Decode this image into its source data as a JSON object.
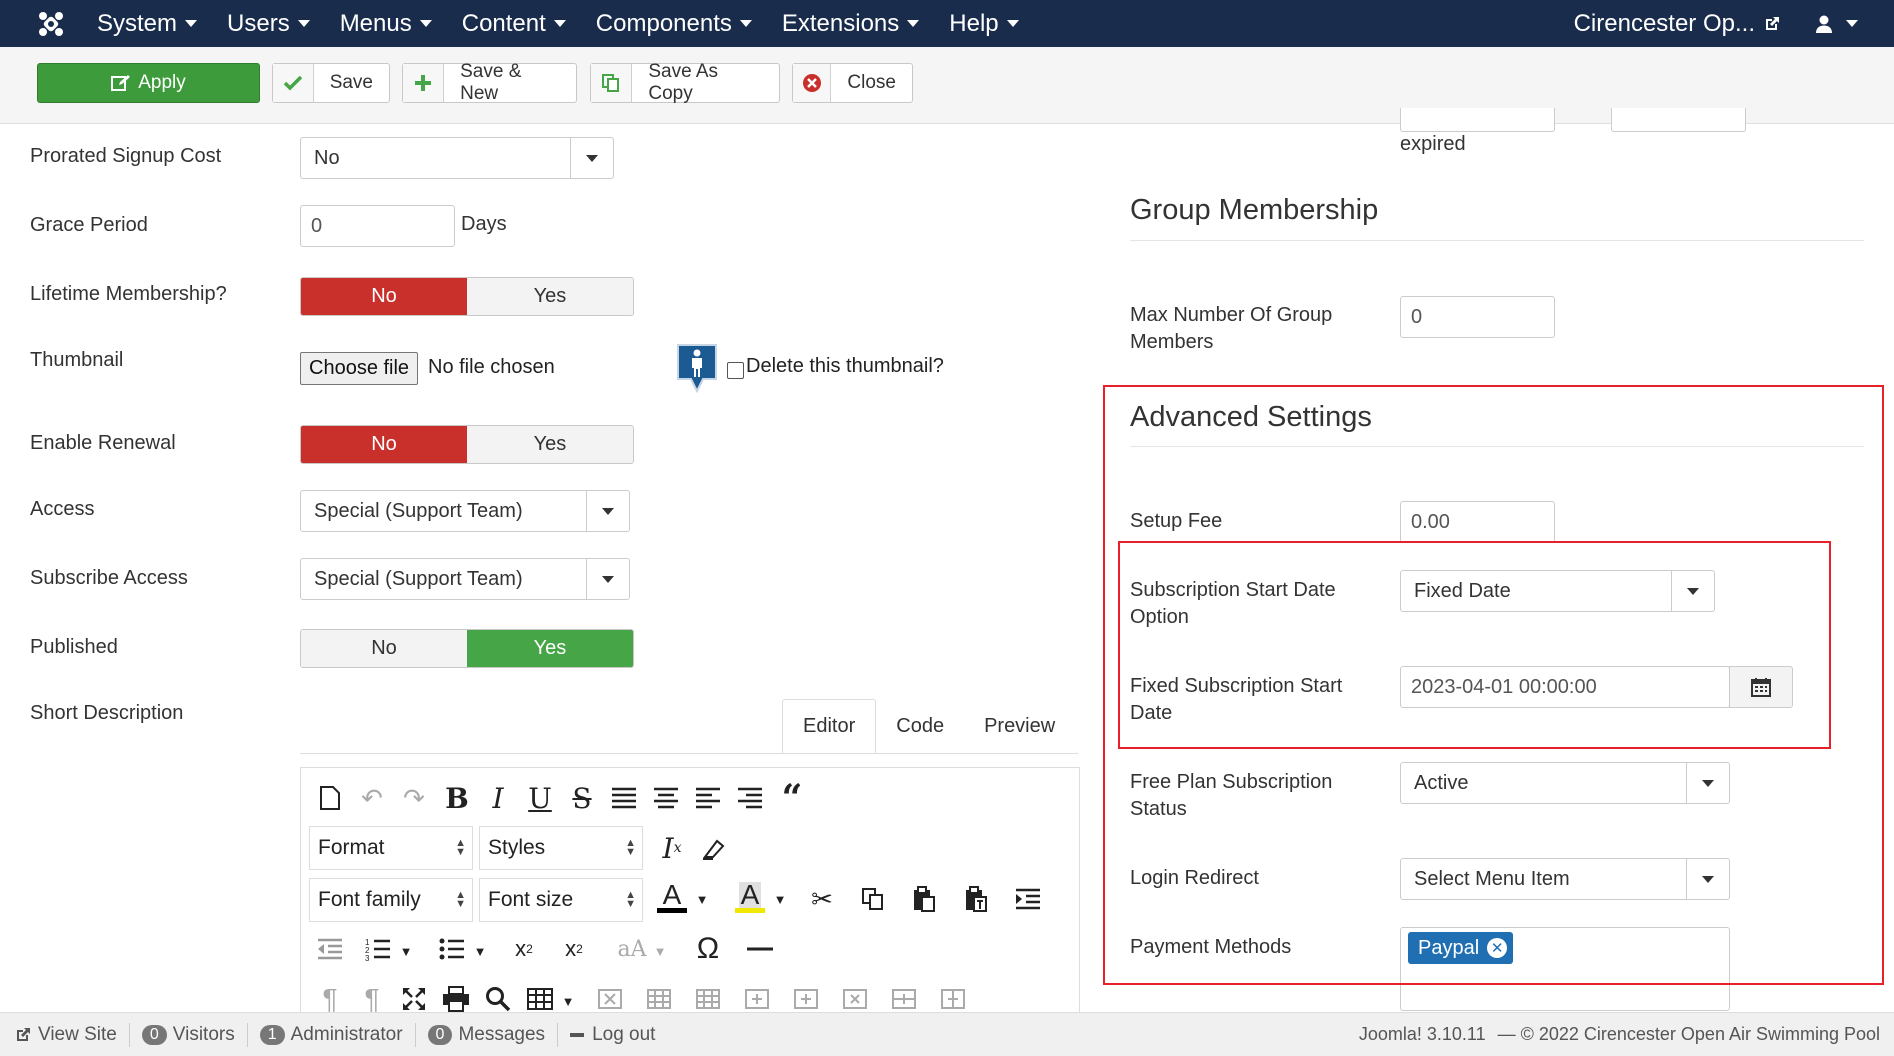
{
  "nav": {
    "menu": [
      "System",
      "Users",
      "Menus",
      "Content",
      "Components",
      "Extensions",
      "Help"
    ],
    "site_name": "Cirencester Op..."
  },
  "toolbar": {
    "apply": "Apply",
    "save": "Save",
    "save_new": "Save & New",
    "save_copy": "Save As Copy",
    "close": "Close"
  },
  "left": {
    "prorated_label": "Prorated Signup Cost",
    "prorated_value": "No",
    "grace_label": "Grace Period",
    "grace_value": "0",
    "grace_unit": "Days",
    "lifetime_label": "Lifetime Membership?",
    "thumbnail_label": "Thumbnail",
    "choose_file": "Choose file",
    "no_file": "No file chosen",
    "delete_thumb": "Delete this thumbnail?",
    "renewal_label": "Enable Renewal",
    "access_label": "Access",
    "access_value": "Special (Support Team)",
    "subscribe_access_label": "Subscribe Access",
    "subscribe_access_value": "Special (Support Team)",
    "published_label": "Published",
    "short_desc_label": "Short Description",
    "no": "No",
    "yes": "Yes"
  },
  "editor": {
    "tabs": [
      "Editor",
      "Code",
      "Preview"
    ],
    "format": "Format",
    "styles": "Styles",
    "font_family": "Font family",
    "font_size": "Font size"
  },
  "right": {
    "expired": "expired",
    "group_title": "Group Membership",
    "max_group_label": "Max Number Of Group Members",
    "max_group_value": "0",
    "adv_title": "Advanced Settings",
    "setup_fee_label": "Setup Fee",
    "setup_fee_value": "0.00",
    "start_option_label": "Subscription Start Date Option",
    "start_option_value": "Fixed Date",
    "fixed_start_label": "Fixed Subscription Start Date",
    "fixed_start_value": "2023-04-01 00:00:00",
    "free_status_label": "Free Plan Subscription Status",
    "free_status_value": "Active",
    "login_redirect_label": "Login Redirect",
    "login_redirect_value": "Select Menu Item",
    "payment_label": "Payment Methods",
    "payment_chip": "Paypal"
  },
  "footer": {
    "view_site": "View Site",
    "visitors_count": "0",
    "visitors": "Visitors",
    "admin_count": "1",
    "admin": "Administrator",
    "messages_count": "0",
    "messages": "Messages",
    "logout": "Log out",
    "version": "Joomla! 3.10.11",
    "copyright": "— © 2022 Cirencester Open Air Swimming Pool"
  },
  "colors": {
    "nav_bg": "#1a2c4c",
    "apply_green": "#3e9b3b",
    "toggle_red": "#c9302c",
    "toggle_green": "#46a546",
    "highlight_red": "#e8202a",
    "chip_blue": "#1f6fb2"
  }
}
